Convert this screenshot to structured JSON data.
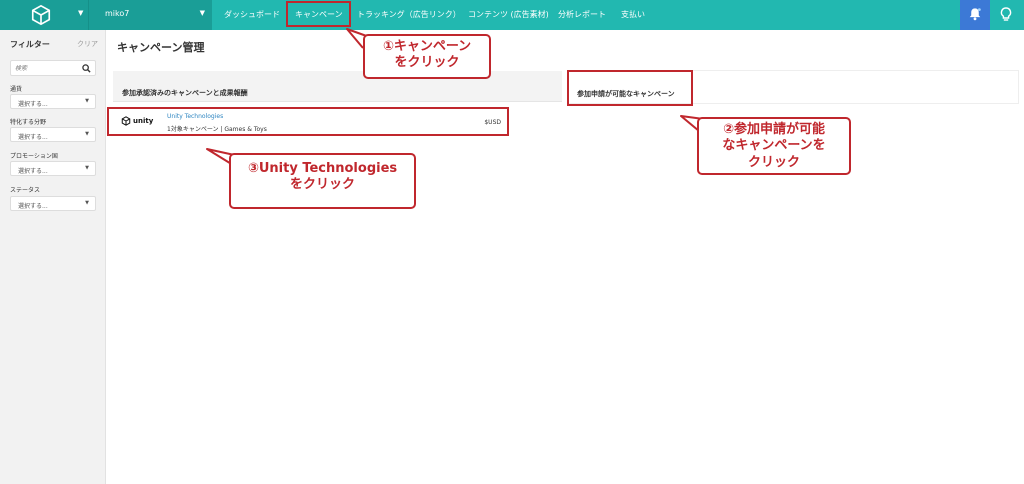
{
  "topbar": {
    "account_name": "miko7",
    "nav": [
      {
        "label": "ダッシュボード"
      },
      {
        "label": "キャンペーン"
      },
      {
        "label": "トラッキング（広告リンク）"
      },
      {
        "label": "コンテンツ (広告素材)"
      },
      {
        "label": "分析レポート"
      },
      {
        "label": "支払い"
      }
    ],
    "colors": {
      "bar": "#22b8b0",
      "bar_dark": "#1a9e97",
      "notification": "#3c79d6"
    }
  },
  "sidebar": {
    "title": "フィルター",
    "clear_label": "クリア",
    "search_placeholder": "検索",
    "filters": [
      {
        "label": "通貨",
        "value": "選択する..."
      },
      {
        "label": "特化する分野",
        "value": "選択する..."
      },
      {
        "label": "プロモーション国",
        "value": "選択する..."
      },
      {
        "label": "ステータス",
        "value": "選択する..."
      }
    ]
  },
  "main": {
    "page_title": "キャンペーン管理",
    "left_panel_title": "参加承認済みのキャンペーンと成果報酬",
    "right_panel_title": "参加申請が可能なキャンペーン",
    "campaign": {
      "brand": "unity",
      "advertiser": "Unity Technologies",
      "subtitle": "1対象キャンペーン | Games & Toys",
      "currency": "$USD"
    }
  },
  "callouts": {
    "c1": [
      "①キャンペーン",
      "をクリック"
    ],
    "c2": [
      "②参加申請が可能",
      "なキャンペーンを",
      "クリック"
    ],
    "c3": [
      "③Unity Technologies",
      "をクリック"
    ],
    "color": "#c0272d"
  }
}
